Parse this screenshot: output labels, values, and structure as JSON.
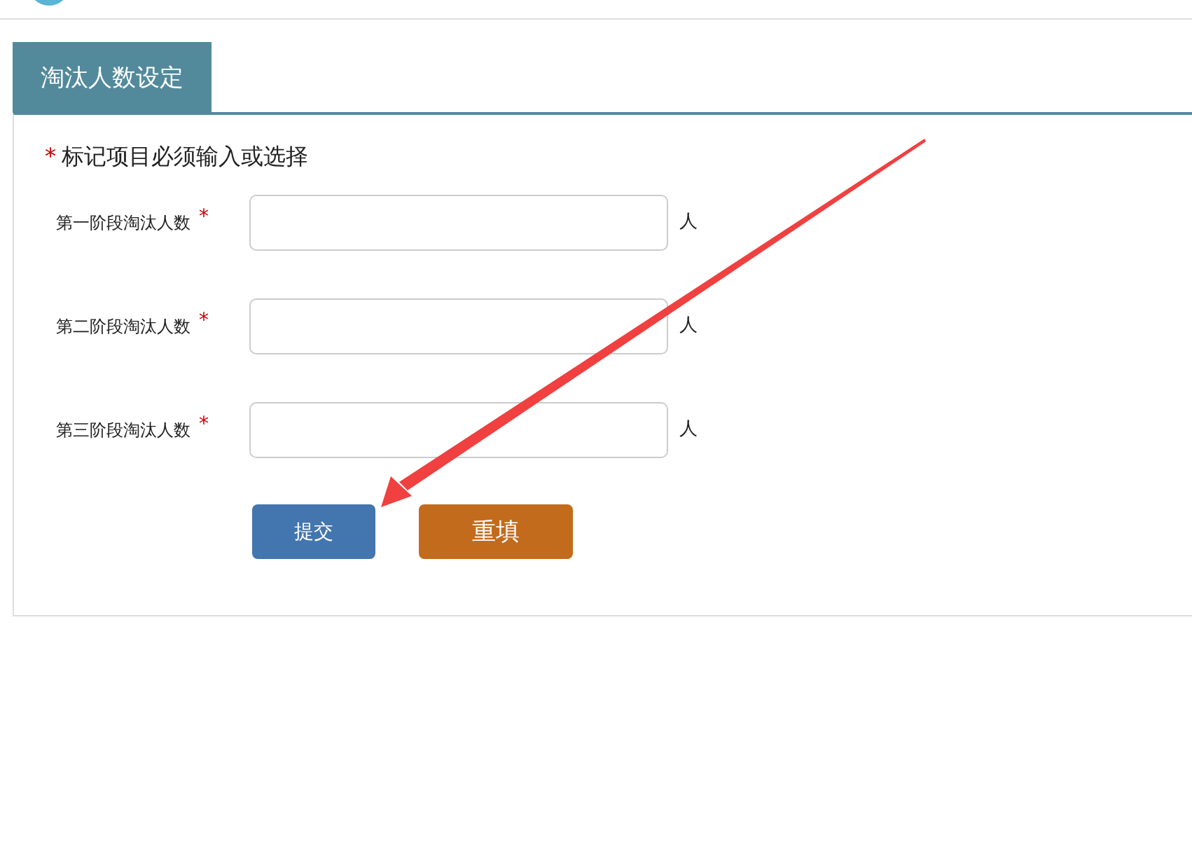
{
  "tab": {
    "label": "淘汰人数设定",
    "selected": true
  },
  "note": {
    "mark": "*",
    "text": "标记项目必须输入或选择"
  },
  "fields": [
    {
      "label": "第一阶段淘汰人数",
      "mark": "*",
      "unit": "人"
    },
    {
      "label": "第二阶段淘汰人数",
      "mark": "*",
      "unit": "人"
    },
    {
      "label": "第三阶段淘汰人数",
      "mark": "*",
      "unit": "人"
    }
  ],
  "buttons": [
    {
      "label": "提交",
      "kind": "submit"
    },
    {
      "label": "重填",
      "kind": "reset"
    }
  ]
}
